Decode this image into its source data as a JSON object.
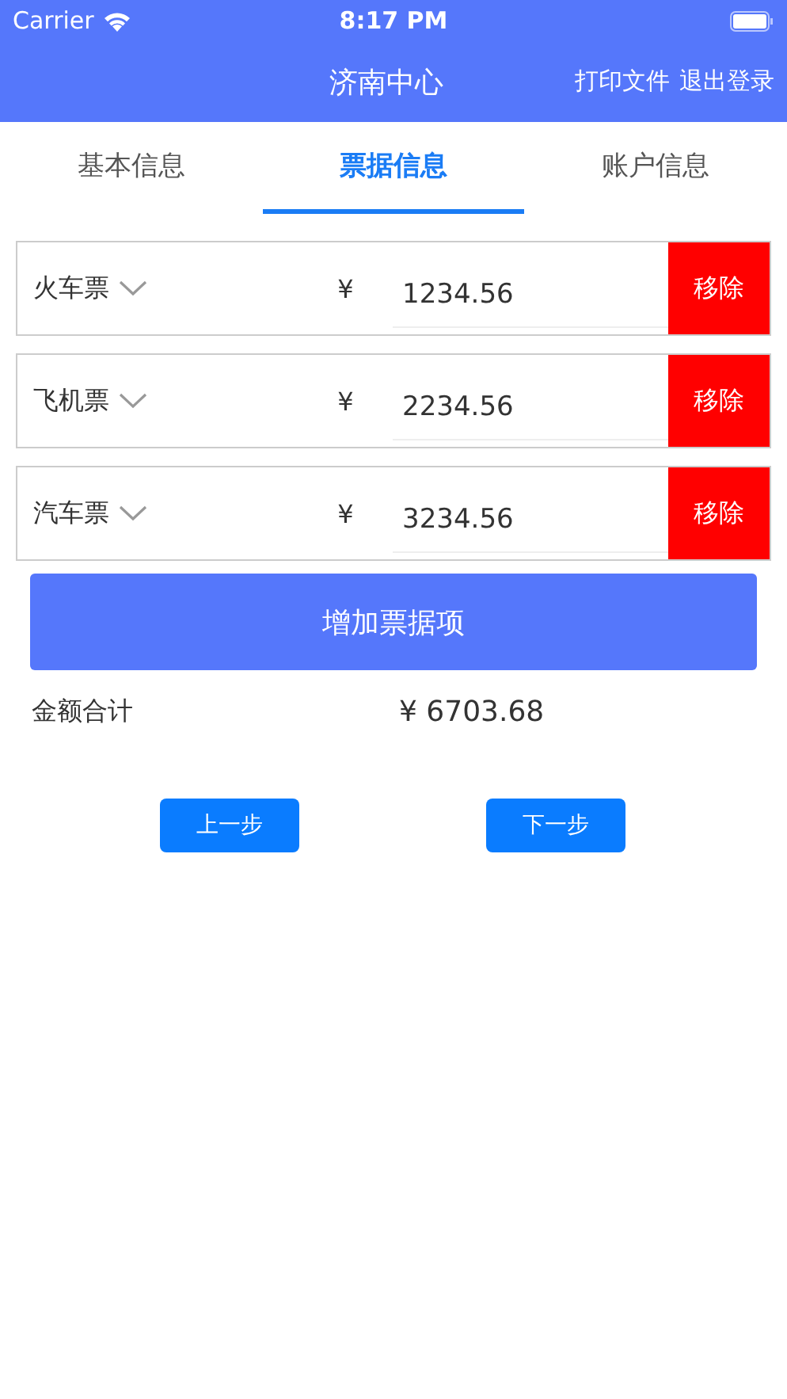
{
  "status_bar": {
    "carrier": "Carrier",
    "time": "8:17 PM"
  },
  "nav": {
    "title": "济南中心",
    "actions": [
      "打印文件",
      "退出登录"
    ]
  },
  "tabs": [
    {
      "label": "基本信息",
      "selected": false
    },
    {
      "label": "票据信息",
      "selected": true
    },
    {
      "label": "账户信息",
      "selected": false
    }
  ],
  "items": [
    {
      "type": "火车票",
      "currency": "¥",
      "amount": "1234.56",
      "remove": "移除"
    },
    {
      "type": "飞机票",
      "currency": "¥",
      "amount": "2234.56",
      "remove": "移除"
    },
    {
      "type": "汽车票",
      "currency": "¥",
      "amount": "3234.56",
      "remove": "移除"
    }
  ],
  "add_button": "增加票据项",
  "total": {
    "label": "金额合计",
    "value": "¥ 6703.68"
  },
  "buttons": [
    "上一步",
    "下一步"
  ]
}
